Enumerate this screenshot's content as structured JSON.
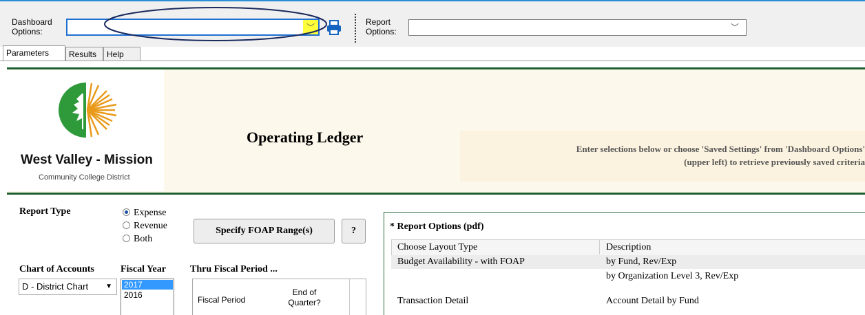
{
  "toolbar": {
    "dashboard_label": "Dashboard\nOptions:",
    "dashboard_value": "",
    "report_label": "Report\nOptions:",
    "report_value": ""
  },
  "tabs": [
    {
      "label": "Parameters",
      "active": true
    },
    {
      "label": "Results",
      "active": false
    },
    {
      "label": "Help",
      "active": false
    }
  ],
  "logo": {
    "name": "West Valley - Mission",
    "subtitle": "Community College District"
  },
  "page_title": "Operating Ledger",
  "instructions": {
    "line1": "Enter selections below or choose 'Saved Settings' from 'Dashboard Options'",
    "line2": "(upper left) to retrieve previously saved criteria"
  },
  "report_type": {
    "label": "Report Type",
    "options": [
      "Expense",
      "Revenue",
      "Both"
    ],
    "selected": "Expense"
  },
  "foap_button": "Specify FOAP Range(s)",
  "help_button": "?",
  "chart_of_accounts": {
    "label": "Chart of Accounts",
    "value": "D - District Chart"
  },
  "fiscal_year": {
    "label": "Fiscal Year",
    "options": [
      "2017",
      "2016"
    ],
    "selected": "2017"
  },
  "thru_period": {
    "label": "Thru Fiscal Period ...",
    "col1": "Fiscal Period",
    "col2": "End of\nQuarter?"
  },
  "report_options": {
    "title": "* Report Options (pdf)",
    "col_layout": "Choose Layout Type",
    "col_desc": "Description",
    "rows": [
      {
        "layout": "Budget Availability - with FOAP",
        "desc": "by Fund, Rev/Exp",
        "highlight": true
      },
      {
        "layout": "",
        "desc": "by Organization Level 3, Rev/Exp",
        "highlight": false
      },
      {
        "layout": "Transaction Detail",
        "desc": "Account Detail by Fund",
        "highlight": false
      }
    ]
  },
  "colors": {
    "accent_green": "#1c5e2e",
    "highlight_yellow": "#ffff3a",
    "printer_blue": "#1565c0",
    "selection_blue": "#3399ff"
  }
}
